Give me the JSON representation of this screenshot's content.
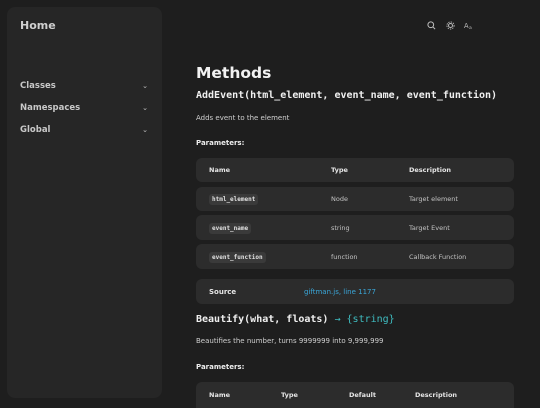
{
  "sidebar": {
    "home": "Home",
    "items": [
      {
        "label": "Classes"
      },
      {
        "label": "Namespaces"
      },
      {
        "label": "Global"
      }
    ]
  },
  "toolbar": {
    "icons": [
      "search-icon",
      "settings-icon",
      "font-size-icon"
    ]
  },
  "main": {
    "section_title": "Methods",
    "methods": [
      {
        "signature": "AddEvent(html_element, event_name, event_function)",
        "description": "Adds event to the element",
        "params_label": "Parameters:",
        "columns": [
          "Name",
          "Type",
          "Description"
        ],
        "params": [
          {
            "name": "html_element",
            "type": "Node",
            "description": "Target element"
          },
          {
            "name": "event_name",
            "type": "string",
            "description": "Target Event"
          },
          {
            "name": "event_function",
            "type": "function",
            "description": "Callback Function"
          }
        ],
        "source_label": "Source",
        "source_link": "giftman.js, line 1177"
      },
      {
        "signature": "Beautify(what, floats)",
        "returns": "→ {string}",
        "description": "Beautifies the number, turns 9999999 into 9,999,999",
        "params_label": "Parameters:",
        "columns": [
          "Name",
          "Type",
          "Default",
          "Description"
        ]
      }
    ]
  },
  "colors": {
    "background": "#1e1e1e",
    "accent": "#3fbcc0",
    "link": "#3aa6d8"
  }
}
